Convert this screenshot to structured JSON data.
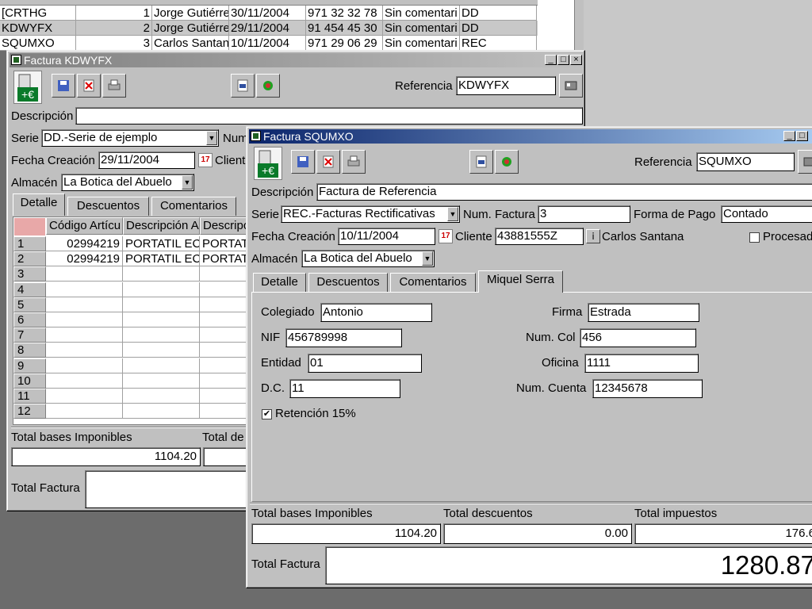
{
  "bg_table": {
    "rows": [
      {
        "ref": "[CRTHG",
        "num": "1",
        "name": "Jorge Gutiérre",
        "date": "30/11/2004",
        "phone": "971 32 32 78",
        "comment": "Sin comentari",
        "serie": "DD"
      },
      {
        "ref": "KDWYFX",
        "num": "2",
        "name": "Jorge Gutiérre",
        "date": "29/11/2004",
        "phone": "91 454 45 30",
        "comment": "Sin comentari",
        "serie": "DD"
      },
      {
        "ref": "SQUMXO",
        "num": "3",
        "name": "Carlos Santan",
        "date": "10/11/2004",
        "phone": "971 29 06 29",
        "comment": "Sin comentari",
        "serie": "REC"
      }
    ]
  },
  "win1": {
    "title": "Factura  KDWYFX",
    "referencia_label": "Referencia",
    "referencia_value": "KDWYFX",
    "descripcion_label": "Descripción",
    "descripcion_value": "",
    "serie_label": "Serie",
    "serie_value": "DD.-Serie de ejemplo",
    "num_label": "Num",
    "fecha_label": "Fecha Creación",
    "fecha_value": "29/11/2004",
    "cliente_label": "Client",
    "almacen_label": "Almacén",
    "almacen_value": "La Botica del Abuelo",
    "tabs": [
      "Detalle",
      "Descuentos",
      "Comentarios"
    ],
    "grid_headers": [
      "Código Artícu",
      "Descripción A",
      "Descripc"
    ],
    "grid_rows": [
      {
        "n": "1",
        "codigo": "02994219",
        "desc1": "PORTATIL EC",
        "desc2": "PORTAT"
      },
      {
        "n": "2",
        "codigo": "02994219",
        "desc1": "PORTATIL EC",
        "desc2": "PORTAT"
      },
      {
        "n": "3"
      },
      {
        "n": "4"
      },
      {
        "n": "5"
      },
      {
        "n": "6"
      },
      {
        "n": "7"
      },
      {
        "n": "8"
      },
      {
        "n": "9"
      },
      {
        "n": "10"
      },
      {
        "n": "11"
      },
      {
        "n": "12"
      }
    ],
    "total_bases_label": "Total bases Imponibles",
    "total_bases_value": "1104.20",
    "total_desc_label": "Total de",
    "total_factura_label": "Total Factura"
  },
  "win2": {
    "title": "Factura  SQUMXO",
    "referencia_label": "Referencia",
    "referencia_value": "SQUMXO",
    "descripcion_label": "Descripción",
    "descripcion_value": "Factura de Referencia",
    "serie_label": "Serie",
    "serie_value": "REC.-Facturas Rectificativas",
    "num_factura_label": "Num. Factura",
    "num_factura_value": "3",
    "forma_pago_label": "Forma de Pago",
    "forma_pago_value": "Contado",
    "fecha_label": "Fecha Creación",
    "fecha_value": "10/11/2004",
    "cliente_label": "Cliente",
    "cliente_value": "43881555Z",
    "cliente_name": "Carlos Santana",
    "procesada_label": "Procesad",
    "almacen_label": "Almacén",
    "almacen_value": "La Botica del Abuelo",
    "tabs": [
      "Detalle",
      "Descuentos",
      "Comentarios",
      "Miquel Serra"
    ],
    "form": {
      "colegiado_label": "Colegiado",
      "colegiado_value": "Antonio",
      "firma_label": "Firma",
      "firma_value": "Estrada",
      "nif_label": "NIF",
      "nif_value": "456789998",
      "numcol_label": "Num. Col",
      "numcol_value": "456",
      "entidad_label": "Entidad",
      "entidad_value": "01",
      "oficina_label": "Oficina",
      "oficina_value": "1111",
      "dc_label": "D.C.",
      "dc_value": "11",
      "numcuenta_label": "Num. Cuenta",
      "numcuenta_value": "12345678",
      "retencion_label": "Retención 15%",
      "retencion_checked": true
    },
    "total_bases_label": "Total bases Imponibles",
    "total_bases_value": "1104.20",
    "total_desc_label": "Total descuentos",
    "total_desc_value": "0.00",
    "total_imp_label": "Total impuestos",
    "total_imp_value": "176.6",
    "total_factura_label": "Total Factura",
    "total_factura_value": "1280.87"
  },
  "colors": {
    "title_active": "#0a246a",
    "title_active_end": "#a6caf0",
    "title_inactive": "#808080",
    "title_inactive_end": "#c0c0c0",
    "desktop": "#6c6c6c",
    "row_header_selected": "#e8a8a8"
  }
}
